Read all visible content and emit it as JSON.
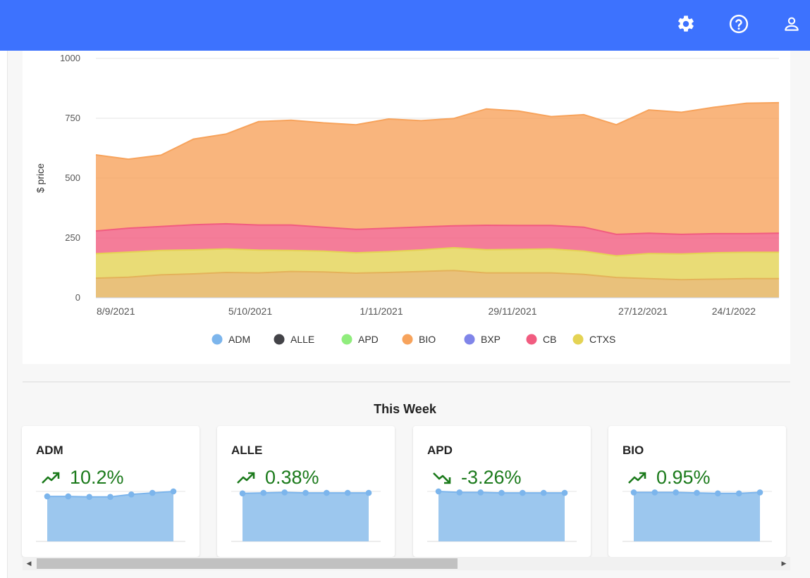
{
  "header": {
    "color": "#3d72fe",
    "icons": [
      "gear-icon",
      "help-icon",
      "user-icon"
    ]
  },
  "chart_data": {
    "type": "area",
    "stacked": true,
    "ylabel": "$ price",
    "ylim": [
      0,
      1000
    ],
    "yticks": [
      "0",
      "250",
      "500",
      "750",
      "1000"
    ],
    "xticks": [
      "8/9/2021",
      "5/10/2021",
      "1/11/2021",
      "29/11/2021",
      "27/12/2021",
      "24/1/2022"
    ],
    "x": [
      "8/9/2021",
      "15/9/2021",
      "22/9/2021",
      "29/9/2021",
      "5/10/2021",
      "12/10/2021",
      "19/10/2021",
      "26/10/2021",
      "1/11/2021",
      "8/11/2021",
      "15/11/2021",
      "22/11/2021",
      "29/11/2021",
      "6/12/2021",
      "13/12/2021",
      "20/12/2021",
      "27/12/2021",
      "3/1/2022",
      "10/1/2022",
      "17/1/2022",
      "24/1/2022",
      "27/1/2022"
    ],
    "grid": true,
    "legend_position": "bottom",
    "series": [
      {
        "name": "ADM",
        "color": "#7cb5ec",
        "values": [
          0,
          0,
          0,
          0,
          0,
          0,
          0,
          0,
          0,
          0,
          0,
          0,
          0,
          0,
          0,
          0,
          0,
          0,
          0,
          0,
          0,
          0
        ]
      },
      {
        "name": "ALLE",
        "color": "#434348",
        "values": [
          0,
          0,
          0,
          0,
          0,
          0,
          0,
          0,
          0,
          0,
          0,
          0,
          0,
          0,
          0,
          0,
          0,
          0,
          0,
          0,
          0,
          0
        ]
      },
      {
        "name": "APD",
        "color": "#90ed7d",
        "values": [
          0,
          0,
          0,
          0,
          0,
          0,
          0,
          0,
          0,
          0,
          0,
          0,
          0,
          0,
          0,
          0,
          0,
          0,
          0,
          0,
          0,
          0
        ]
      },
      {
        "name": "BIO",
        "color": "#f7a35c",
        "values": [
          318,
          288,
          298,
          358,
          375,
          432,
          438,
          436,
          437,
          456,
          444,
          448,
          486,
          478,
          455,
          470,
          458,
          515,
          510,
          528,
          545,
          545
        ]
      },
      {
        "name": "BXP",
        "color": "#8085e9",
        "values": [
          0,
          0,
          0,
          0,
          0,
          0,
          0,
          0,
          0,
          0,
          0,
          0,
          0,
          0,
          0,
          0,
          0,
          0,
          0,
          0,
          0,
          0
        ]
      },
      {
        "name": "CB",
        "color": "#f15c80",
        "values": [
          95,
          100,
          100,
          105,
          105,
          105,
          106,
          100,
          98,
          98,
          96,
          92,
          102,
          100,
          98,
          100,
          90,
          85,
          82,
          80,
          78,
          80
        ]
      },
      {
        "name": "CTXS",
        "color": "#e4d354",
        "values": [
          102,
          105,
          102,
          100,
          98,
          95,
          88,
          87,
          85,
          87,
          90,
          95,
          97,
          98,
          100,
          97,
          90,
          105,
          107,
          110,
          110,
          110
        ]
      },
      {
        "name": "",
        "color": "#e4b25a",
        "values": [
          82,
          86,
          96,
          100,
          106,
          104,
          110,
          108,
          103,
          106,
          110,
          114,
          104,
          104,
          104,
          98,
          85,
          80,
          76,
          78,
          80,
          80
        ]
      }
    ]
  },
  "this_week": {
    "title": "This Week",
    "cards": [
      {
        "ticker": "ADM",
        "change": "10.2%",
        "direction": "up",
        "values": [
          0.9,
          0.9,
          0.89,
          0.89,
          0.94,
          0.97,
          1.0
        ]
      },
      {
        "ticker": "ALLE",
        "change": "0.38%",
        "direction": "up",
        "values": [
          0.96,
          0.97,
          0.98,
          0.97,
          0.97,
          0.97,
          0.97
        ]
      },
      {
        "ticker": "APD",
        "change": "-3.26%",
        "direction": "down",
        "values": [
          1.0,
          0.98,
          0.98,
          0.97,
          0.97,
          0.97,
          0.97
        ]
      },
      {
        "ticker": "BIO",
        "change": "0.95%",
        "direction": "up",
        "values": [
          0.98,
          0.98,
          0.98,
          0.97,
          0.96,
          0.96,
          0.98
        ]
      }
    ]
  },
  "accent_colors": {
    "positive": "#1b7a1b",
    "spark_fill": "#9cc7ee",
    "spark_line": "#7cb5ec"
  }
}
